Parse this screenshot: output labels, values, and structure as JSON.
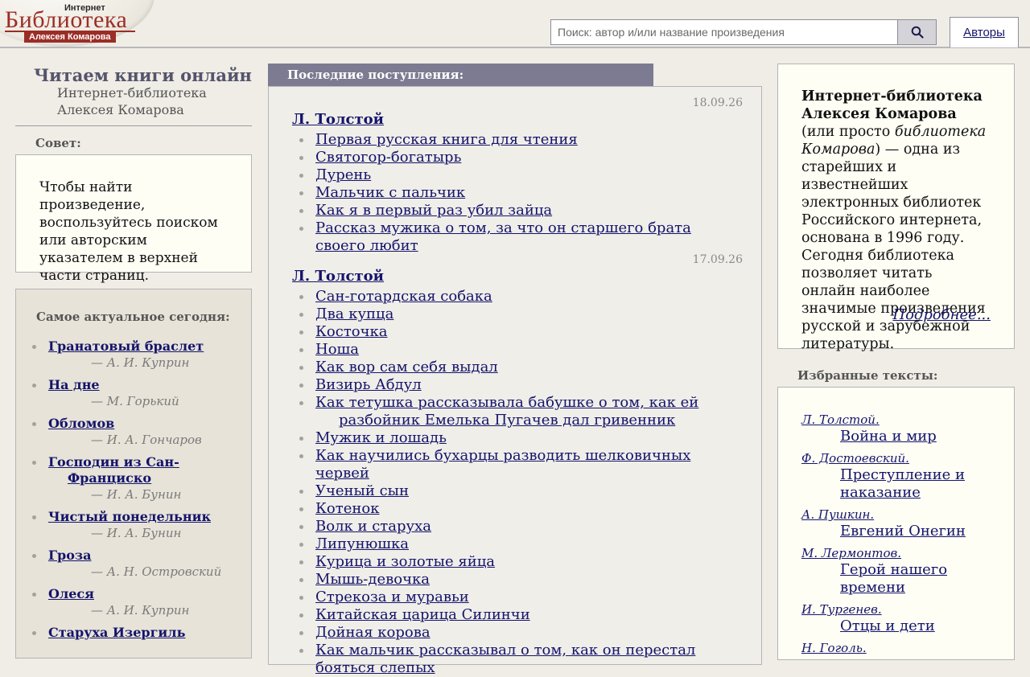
{
  "header": {
    "logo": {
      "top": "Интернет",
      "main": "Библиотека",
      "sub": "Алексея Комарова"
    },
    "search": {
      "placeholder": "Поиск: автор и/или название произведения",
      "button_icon": "search-icon"
    },
    "authors_label": "Авторы"
  },
  "left": {
    "title": "Читаем книги онлайн",
    "subtitle_line1": "Интернет-библиотека",
    "subtitle_line2": "Алексея Комарова",
    "tip_heading": "Совет:",
    "tip_text": "Чтобы найти произведение, воспользуйтесь поиском или авторским указателем в верхней части страниц.",
    "top_heading": "Самое актуальное сегодня:",
    "top_items": [
      {
        "title": "Гранатовый браслет",
        "author": "— А. И. Куприн"
      },
      {
        "title": "На дне",
        "author": "— М. Горький"
      },
      {
        "title": "Обломов",
        "author": "— И. А. Гончаров"
      },
      {
        "title": "Господин из Сан-Франциско",
        "author": "— И. А. Бунин"
      },
      {
        "title": "Чистый понедельник",
        "author": "— И. А. Бунин"
      },
      {
        "title": "Гроза",
        "author": "— А. Н. Островский"
      },
      {
        "title": "Олеся",
        "author": "— А. И. Куприн"
      },
      {
        "title": "Старуха Изергиль",
        "author": ""
      }
    ]
  },
  "news": {
    "heading": "Последние поступления:",
    "groups": [
      {
        "date": "18.09.26",
        "author": "Л. Толстой",
        "items": [
          "Первая русская книга для чтения",
          "Святогор-богатырь",
          "Дурень",
          "Мальчик с пальчик",
          "Как я в первый раз убил зайца",
          "Рассказ мужика о том, за что он старшего брата своего любит"
        ]
      },
      {
        "date": "17.09.26",
        "author": "Л. Толстой",
        "items": [
          "Сан-готардская собака",
          "Два купца",
          "Косточка",
          "Ноша",
          "Как вор сам себя выдал",
          "Визирь Абдул",
          "Как тетушка рассказывала бабушке о том, как ей разбойник Емелька Пугачев дал гривенник",
          "Мужик и лошадь",
          "Как научились бухарцы разводить шелковичных червей",
          "Ученый сын",
          "Котенок",
          "Волк и старуха",
          "Липунюшка",
          "Курица и золотые яйца",
          "Мышь-девочка",
          "Стрекоза и муравьи",
          "Китайская царица Силинчи",
          "Дойная корова",
          "Как мальчик рассказывал о том, как он перестал бояться слепых"
        ]
      }
    ]
  },
  "about": {
    "bold": "Интернет-библиотека Алексея Комарова",
    "part1": " (или просто ",
    "italic": "библиотека Комарова",
    "part2": ") — одна из старейших и известнейших электронных библиотек Российского интернета, основана в 1996 году. Сегодня библиотека позволяет читать онлайн наиболее значимые произведения русской и зарубежной литературы.",
    "more": "Подробнее..."
  },
  "favorites": {
    "heading": "Избранные тексты:",
    "items": [
      {
        "author": "Л. Толстой.",
        "title": "Война и мир"
      },
      {
        "author": "Ф. Достоевский.",
        "title": "Преступление и наказание"
      },
      {
        "author": "А. Пушкин.",
        "title": "Евгений Онегин"
      },
      {
        "author": "М. Лермонтов.",
        "title": "Герой нашего времени"
      },
      {
        "author": "И. Тургенев.",
        "title": "Отцы и дети"
      },
      {
        "author": "Н. Гоголь.",
        "title": ""
      }
    ]
  }
}
